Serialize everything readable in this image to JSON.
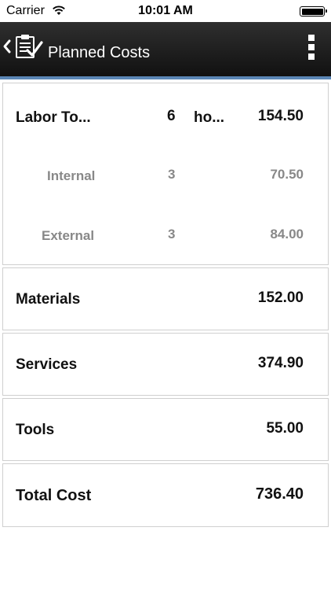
{
  "status_bar": {
    "carrier": "Carrier",
    "time": "10:01 AM"
  },
  "nav": {
    "title": "Planned Costs",
    "back_icon": "chevron-left-icon",
    "page_icon": "clipboard-check-icon",
    "menu_icon": "vertical-ellipsis-icon"
  },
  "labor": {
    "label": "Labor To...",
    "qty": "6",
    "unit": "ho...",
    "value": "154.50",
    "internal": {
      "label": "Internal",
      "qty": "3",
      "value": "70.50"
    },
    "external": {
      "label": "External",
      "qty": "3",
      "value": "84.00"
    }
  },
  "materials": {
    "label": "Materials",
    "value": "152.00"
  },
  "services": {
    "label": "Services",
    "value": "374.90"
  },
  "tools": {
    "label": "Tools",
    "value": "55.00"
  },
  "total": {
    "label": "Total Cost",
    "value": "736.40"
  },
  "colors": {
    "nav_background": "#1c1c1c",
    "accent_line": "#5b86b5",
    "secondary_text": "#888888"
  }
}
